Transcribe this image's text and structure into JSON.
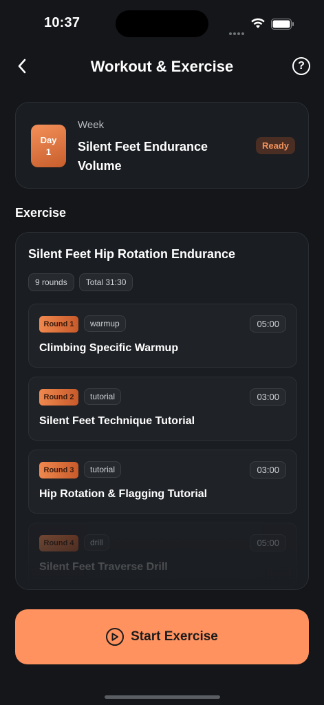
{
  "status_bar": {
    "time": "10:37"
  },
  "header": {
    "title": "Workout & Exercise",
    "help_symbol": "?"
  },
  "day_card": {
    "badge_line1": "Day",
    "badge_line2": "1",
    "week_label": "Week",
    "workout_name": "Silent Feet Endurance Volume",
    "status": "Ready"
  },
  "section_title": "Exercise",
  "exercise": {
    "title": "Silent Feet Hip Rotation Endurance",
    "rounds_count": "9 rounds",
    "total": "Total 31:30",
    "rounds": [
      {
        "round": "Round 1",
        "type": "warmup",
        "duration": "05:00",
        "name": "Climbing Specific Warmup"
      },
      {
        "round": "Round 2",
        "type": "tutorial",
        "duration": "03:00",
        "name": "Silent Feet Technique Tutorial"
      },
      {
        "round": "Round 3",
        "type": "tutorial",
        "duration": "03:00",
        "name": "Hip Rotation & Flagging Tutorial"
      },
      {
        "round": "Round 4",
        "type": "drill",
        "duration": "05:00",
        "name": "Silent Feet Traverse Drill"
      }
    ]
  },
  "start_button": {
    "label": "Start Exercise"
  },
  "colors": {
    "accent": "#ff925f",
    "background": "#141619",
    "card": "#1a1d21"
  },
  "icons": {
    "back": "chevron-left-icon",
    "help": "help-circle-icon",
    "play": "play-circle-icon"
  }
}
